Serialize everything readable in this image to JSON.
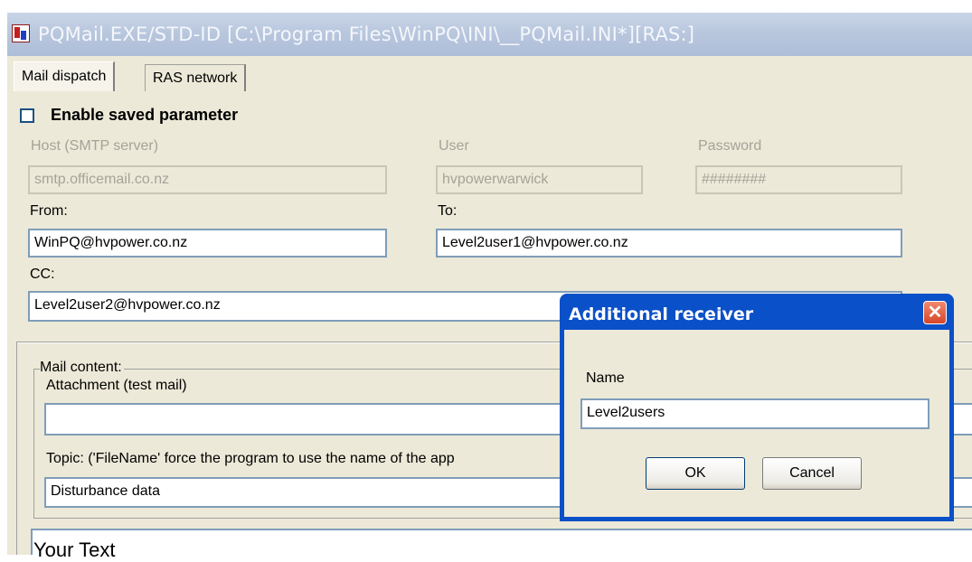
{
  "window": {
    "title": "PQMail.EXE/STD-ID [C:\\Program Files\\WinPQ\\INI\\__PQMail.INI*][RAS:]"
  },
  "tabs": [
    {
      "label": "Mail dispatch",
      "active": true
    },
    {
      "label": "RAS network",
      "active": false
    }
  ],
  "form": {
    "enable_saved_label": "Enable saved parameter",
    "enable_saved_checked": false,
    "host_label": "Host (SMTP server)",
    "host_value": "smtp.officemail.co.nz",
    "user_label": "User",
    "user_value": "hvpowerwarwick",
    "password_label": "Password",
    "password_value": "########",
    "from_label": "From:",
    "from_value": "WinPQ@hvpower.co.nz",
    "to_label": "To:",
    "to_value": "Level2user1@hvpower.co.nz",
    "cc_label": "CC:",
    "cc_value": "Level2user2@hvpower.co.nz"
  },
  "content": {
    "group_label": "Mail content:",
    "attachment_label": "Attachment (test mail)",
    "attachment_value": "",
    "topic_label": "Topic: ('FileName' force the program to use the name of the app",
    "topic_value": "Disturbance data",
    "body_text": "Your Text"
  },
  "dialog": {
    "title": "Additional receiver",
    "name_label": "Name",
    "name_value": "Level2users",
    "ok_label": "OK",
    "cancel_label": "Cancel"
  },
  "icons": {
    "app": "app-chart-icon",
    "close": "close-x-icon"
  },
  "colors": {
    "dialog_title": "#0a50c8",
    "window_title_inactive": "#b8c6dd",
    "face": "#ece9d8",
    "close": "#d6452a"
  }
}
